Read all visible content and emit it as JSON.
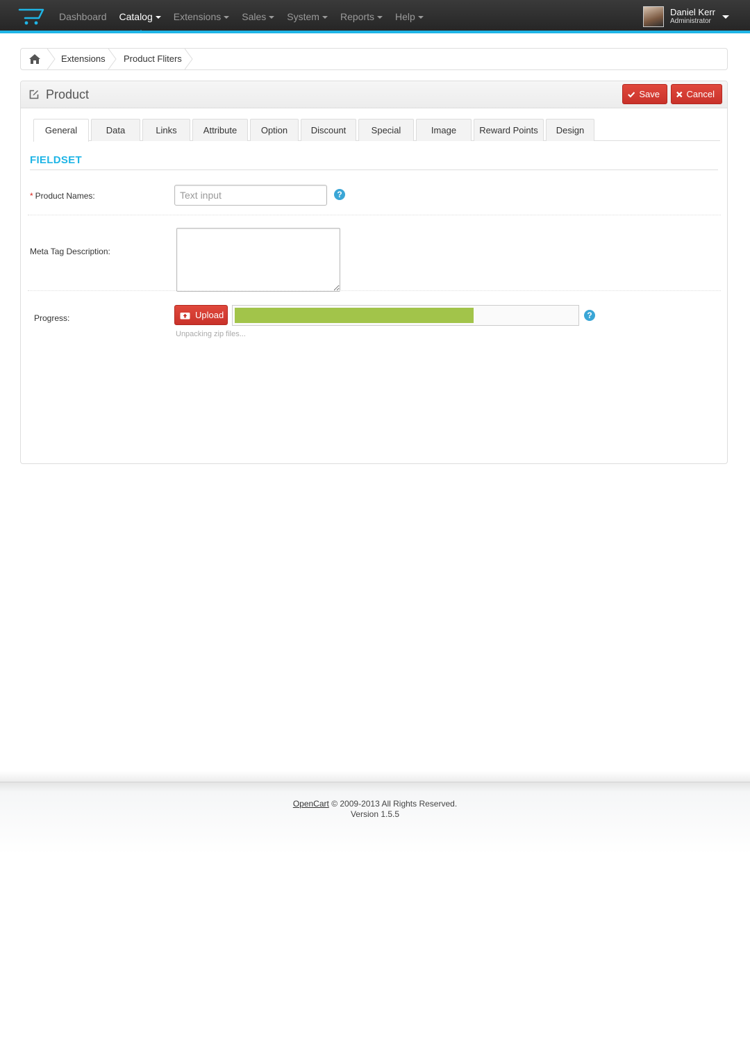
{
  "nav": {
    "items": [
      {
        "label": "Dashboard",
        "has_caret": false,
        "active": false
      },
      {
        "label": "Catalog",
        "has_caret": true,
        "active": true
      },
      {
        "label": "Extensions",
        "has_caret": true,
        "active": false
      },
      {
        "label": "Sales",
        "has_caret": true,
        "active": false
      },
      {
        "label": "System",
        "has_caret": true,
        "active": false
      },
      {
        "label": "Reports",
        "has_caret": true,
        "active": false
      },
      {
        "label": "Help",
        "has_caret": true,
        "active": false
      }
    ],
    "user": {
      "name": "Daniel Kerr",
      "role": "Administrator"
    }
  },
  "breadcrumb": {
    "home_icon": "home-icon",
    "items": [
      "Extensions",
      "Product Fliters"
    ]
  },
  "panel": {
    "title": "Product",
    "title_icon": "edit-icon",
    "save_label": "Save",
    "cancel_label": "Cancel",
    "tabs": [
      "General",
      "Data",
      "Links",
      "Attribute",
      "Option",
      "Discount",
      "Special",
      "Image",
      "Reward Points",
      "Design"
    ],
    "active_tab": "General"
  },
  "form": {
    "fieldset_title": "FIELDSET",
    "product_names": {
      "required_mark": "*",
      "label": "Product Names:",
      "placeholder": "Text input",
      "value": ""
    },
    "meta_description": {
      "label": "Meta Tag Description:",
      "value": ""
    },
    "progress": {
      "label": "Progress:",
      "upload_label": "Upload",
      "percent": 70,
      "status": "Unpacking zip files..."
    }
  },
  "footer": {
    "link_text": "OpenCart",
    "copyright": "© 2009-2013 All Rights Reserved.",
    "version": "Version 1.5.5"
  },
  "colors": {
    "accent": "#1fb5e6",
    "button_red": "#d13d32",
    "progress_green": "#a2c44a",
    "help_blue": "#3aa6d6"
  }
}
